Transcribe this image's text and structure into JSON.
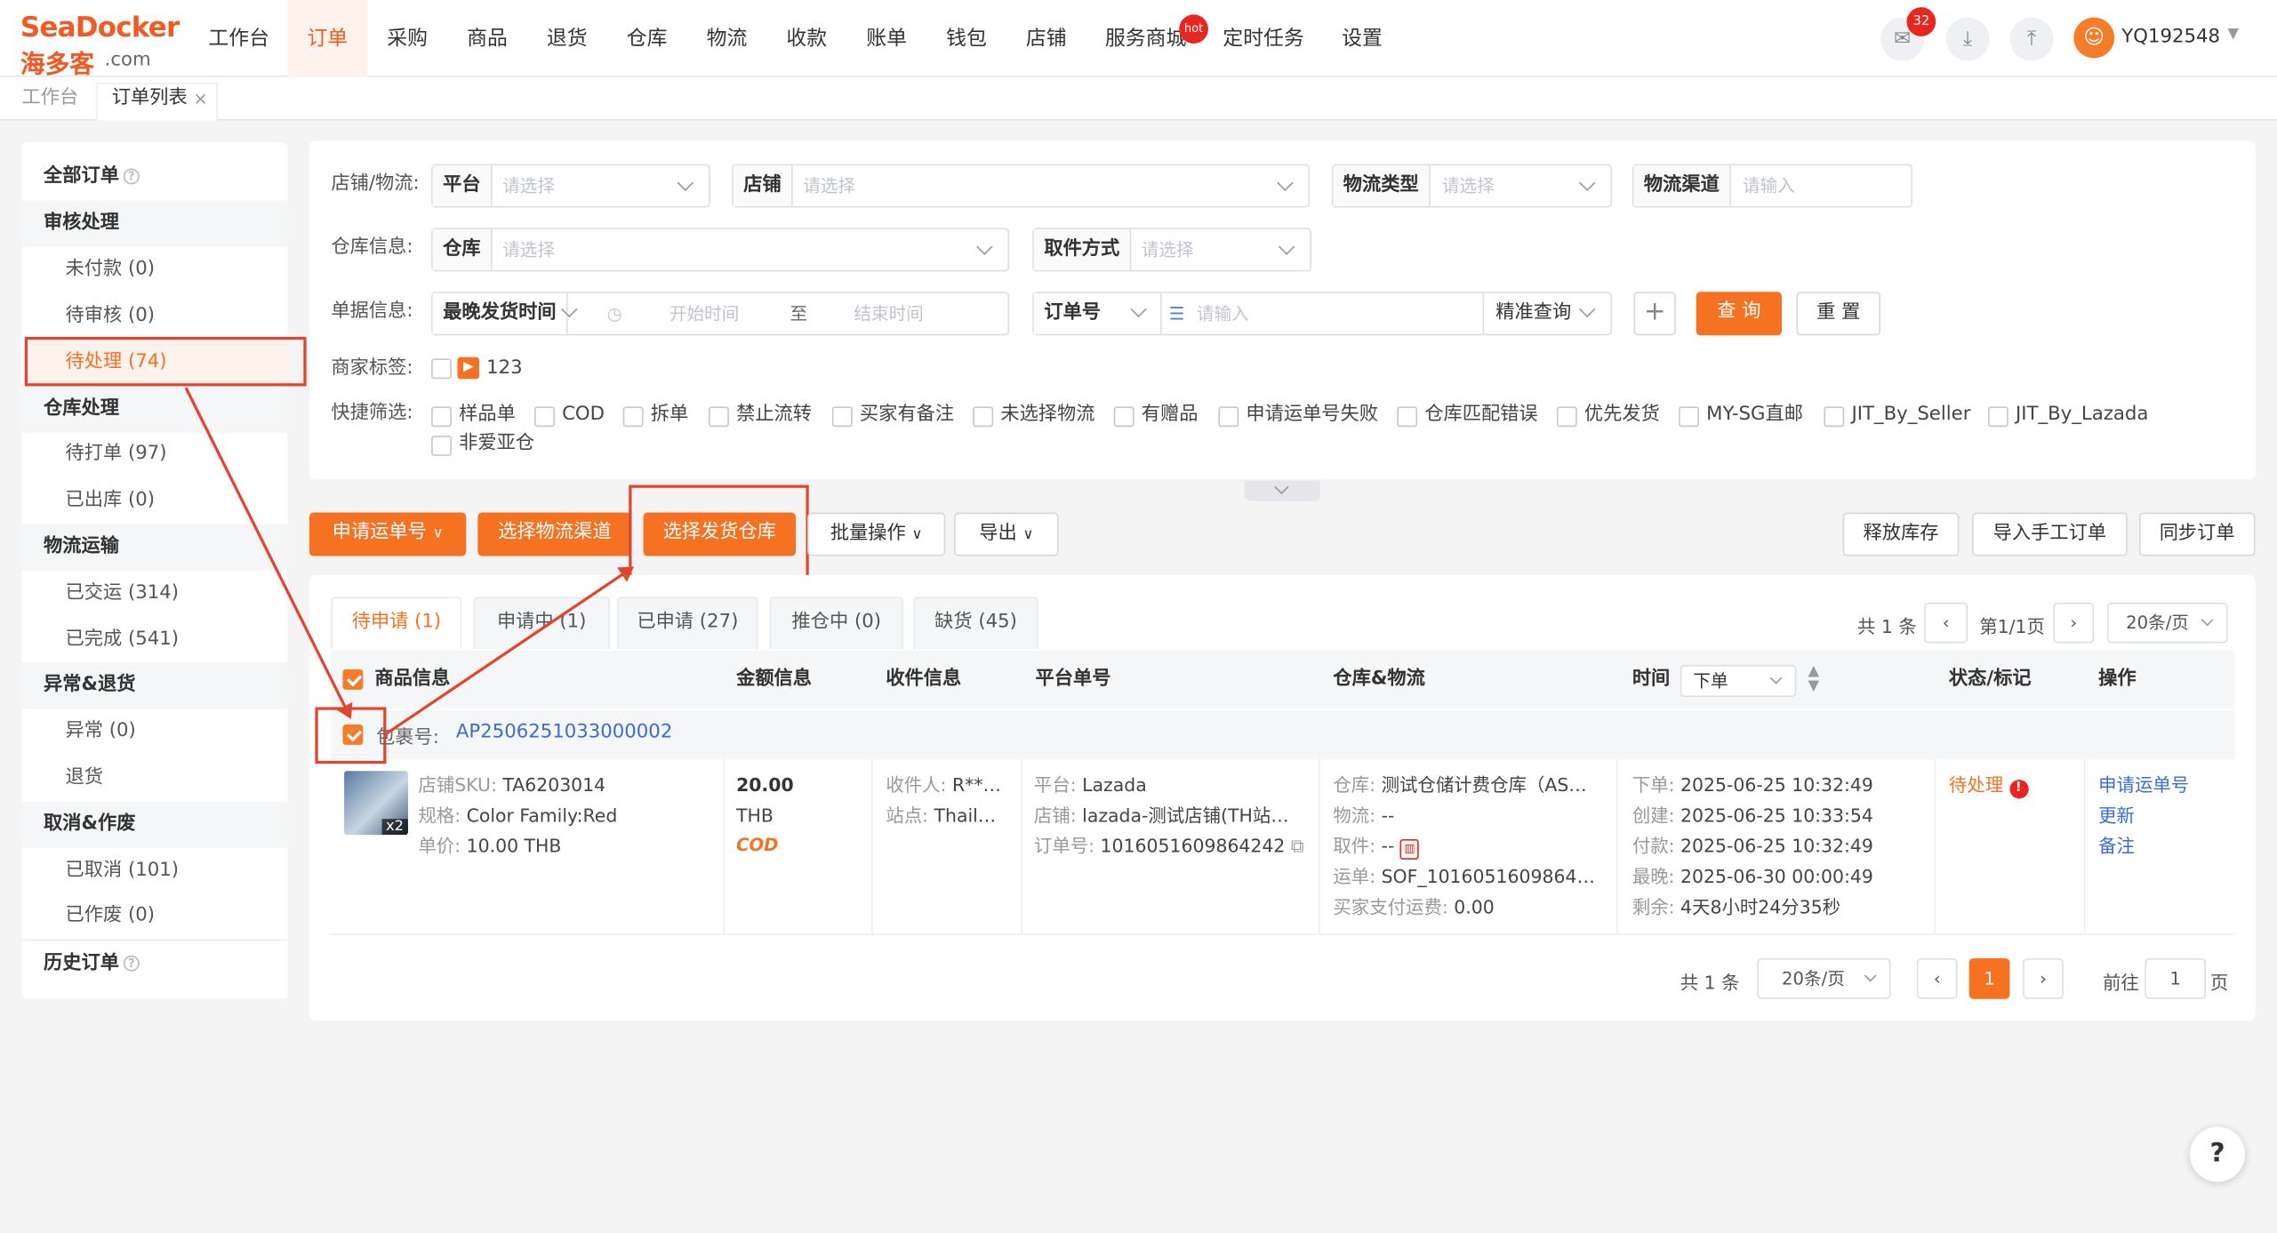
{
  "brand": {
    "top": "SeaDocker",
    "cn": "海多客",
    "dotcom": ".com",
    "accent": "#f05a24",
    "button_orange": "#f57222"
  },
  "nav": {
    "items": [
      "工作台",
      "订单",
      "采购",
      "商品",
      "退货",
      "仓库",
      "物流",
      "收款",
      "账单",
      "钱包",
      "店铺",
      "服务商城",
      "定时任务",
      "设置"
    ],
    "active": "订单",
    "hot_badge": "hot",
    "notice_count": "32",
    "user": "YQ192548"
  },
  "tabs": {
    "home": "工作台",
    "current": "订单列表",
    "close": "×"
  },
  "sidebar": {
    "all": "全部订单",
    "audit": "审核处理",
    "unpaid": "未付款 (0)",
    "pending_review": "待审核 (0)",
    "pending": "待处理 (74)",
    "warehouse": "仓库处理",
    "to_print": "待打单 (97)",
    "shipped_out": "已出库 (0)",
    "logistics": "物流运输",
    "delivered": "已交运 (314)",
    "completed": "已完成 (541)",
    "abnormal": "异常&退货",
    "exception": "异常 (0)",
    "returns": "退货",
    "cancel": "取消&作废",
    "cancelled": "已取消 (101)",
    "voided": "已作废 (0)",
    "history": "历史订单"
  },
  "filters": {
    "shop_logistics": "店铺/物流:",
    "platform": "平台",
    "shop": "店铺",
    "logistics_type": "物流类型",
    "logistics_channel": "物流渠道",
    "placeholder_select": "请选择",
    "placeholder_input": "请输入",
    "warehouse_info": "仓库信息:",
    "warehouse": "仓库",
    "pickup": "取件方式",
    "doc_info": "单据信息:",
    "latest_ship_time": "最晚发货时间",
    "start_time": "开始时间",
    "to": "至",
    "end_time": "结束时间",
    "order_no": "订单号",
    "exact_query": "精准查询",
    "plus": "+",
    "query": "查 询",
    "reset": "重 置",
    "merchant_tag": "商家标签:",
    "tag_value": "123",
    "quick_filter": "快捷筛选:",
    "quick": [
      "样品单",
      "COD",
      "拆单",
      "禁止流转",
      "买家有备注",
      "未选择物流",
      "有赠品",
      "申请运单号失败",
      "仓库匹配错误",
      "优先发货",
      "MY-SG直邮",
      "JIT_By_Seller",
      "JIT_By_Lazada",
      "非爱亚仓"
    ]
  },
  "actions": {
    "apply_waybill": "申请运单号",
    "select_channel": "选择物流渠道",
    "select_warehouse": "选择发货仓库",
    "batch": "批量操作",
    "export": "导出",
    "release_stock": "释放库存",
    "import_manual": "导入手工订单",
    "sync_orders": "同步订单"
  },
  "subtabs": [
    "待申请 (1)",
    "申请中 (1)",
    "已申请 (27)",
    "推仓中 (0)",
    "缺货 (45)"
  ],
  "pager_top": {
    "total": "共 1 条",
    "page": "第1/1页",
    "size": "20条/页",
    "prev": "‹",
    "next": "›"
  },
  "table": {
    "headers": [
      "商品信息",
      "金额信息",
      "收件信息",
      "平台单号",
      "仓库&物流",
      "时间",
      "状态/标记",
      "操作"
    ],
    "time_sort": "下单",
    "package_label": "包裹号:",
    "package_no": "AP2506251033000002",
    "sku_label": "店铺SKU:",
    "sku": "TA6203014",
    "spec_label": "规格:",
    "spec": "Color Family:Red",
    "unit_label": "单价:",
    "unit": "10.00 THB",
    "qty": "x2",
    "amount": "20.00",
    "currency": "THB",
    "cod": "COD",
    "receiver_label": "收件人:",
    "receiver": "R**…",
    "site_label": "站点:",
    "site": "Thail…",
    "platform_label": "平台:",
    "platform": "Lazada",
    "shop_label": "店铺:",
    "shop": "lazada-测试店铺(TH站…",
    "orderno_label": "订单号:",
    "orderno": "1016051609864242",
    "wh_label": "仓库:",
    "wh": "测试仓储计费仓库（AS…",
    "log_label": "物流:",
    "log": "--",
    "pick_label": "取件:",
    "pick": "--",
    "waybill_label": "运单:",
    "waybill": "SOF_1016051609864…",
    "fee_label": "买家支付运费:",
    "fee": "0.00",
    "t1_label": "下单:",
    "t1": "2025-06-25 10:32:49",
    "t2_label": "创建:",
    "t2": "2025-06-25 10:33:54",
    "t3_label": "付款:",
    "t3": "2025-06-25 10:32:49",
    "t4_label": "最晚:",
    "t4": "2025-06-30 00:00:49",
    "t5_label": "剩余:",
    "t5": "4天8小时24分35秒",
    "status": "待处理",
    "ops": [
      "申请运单号",
      "更新",
      "备注"
    ]
  },
  "pager_bottom": {
    "total": "共 1 条",
    "size": "20条/页",
    "page": "1",
    "goto": "前往",
    "goto_val": "1",
    "unit": "页"
  },
  "help": "?"
}
